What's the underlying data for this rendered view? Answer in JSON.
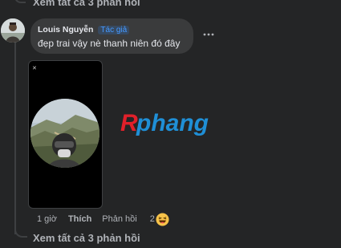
{
  "thread": {
    "view_more_top": "Xem tất cả 3 phản hồi",
    "view_more_bottom": "Xem tất cả 3 phản hồi"
  },
  "comment": {
    "author": "Louis Nguyễn",
    "badge": "Tác giả",
    "text": "đẹp trai vậy nè thanh niên đó đây",
    "more_icon": "more-horizontal-icon",
    "media_close_icon": "close-icon",
    "time": "1 giờ",
    "like_label": "Thích",
    "reply_label": "Phản hồi",
    "reaction_count": "2",
    "reaction_icon": "haha-emoji-icon"
  },
  "watermark": {
    "text": "Rphang",
    "color_primary": "#e0202a",
    "color_secondary": "#1f8fd6"
  },
  "colors": {
    "background": "#242526",
    "bubble": "#3a3b3c",
    "text_primary": "#e4e6eb",
    "text_secondary": "#b0b3b8",
    "badge": "#4599ff"
  }
}
